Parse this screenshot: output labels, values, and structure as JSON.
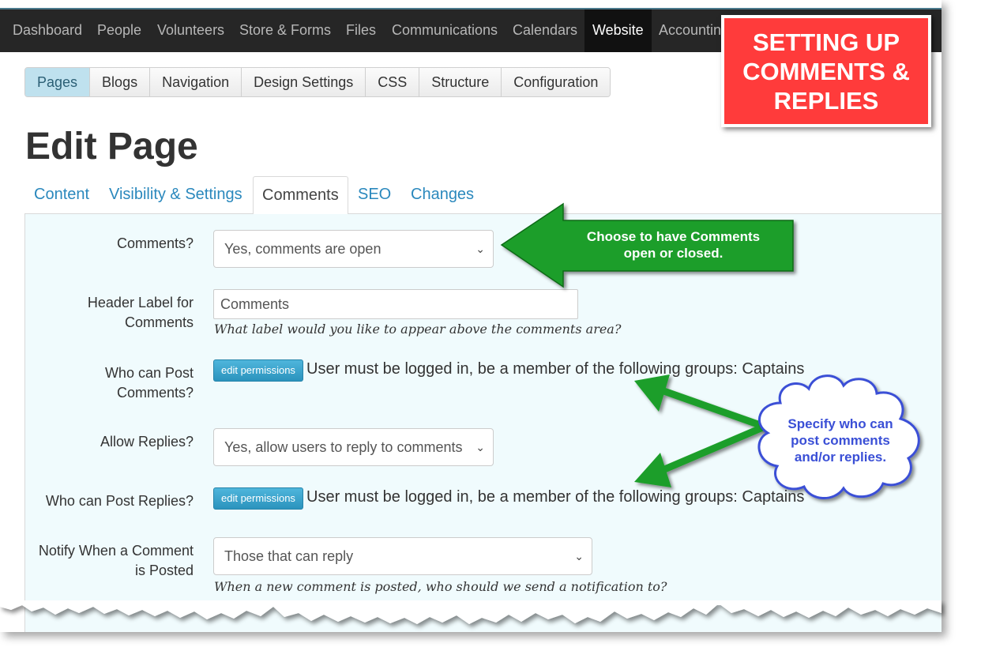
{
  "topnav": {
    "items": [
      "Dashboard",
      "People",
      "Volunteers",
      "Store & Forms",
      "Files",
      "Communications",
      "Calendars",
      "Website",
      "Accounting"
    ],
    "active": "Website"
  },
  "subtabs": {
    "items": [
      "Pages",
      "Blogs",
      "Navigation",
      "Design Settings",
      "CSS",
      "Structure",
      "Configuration"
    ],
    "active": "Pages"
  },
  "page": {
    "title": "Edit Page"
  },
  "tabs": {
    "items": [
      "Content",
      "Visibility & Settings",
      "Comments",
      "SEO",
      "Changes"
    ],
    "active": "Comments"
  },
  "form": {
    "comments": {
      "label": "Comments?",
      "value": "Yes, comments are open"
    },
    "header_label": {
      "label_line1": "Header Label for",
      "label_line2": "Comments",
      "value": "Comments",
      "help": "What label would you like to appear above the comments area?"
    },
    "who_post_comments": {
      "label_line1": "Who can Post",
      "label_line2": "Comments?",
      "button": "edit permissions",
      "text": "User must be logged in, be a member of the following groups: Captains"
    },
    "allow_replies": {
      "label": "Allow Replies?",
      "value": "Yes, allow users to reply to comments"
    },
    "who_post_replies": {
      "label": "Who can Post Replies?",
      "button": "edit permissions",
      "text": "User must be logged in, be a member of the following groups: Captains"
    },
    "notify": {
      "label_line1": "Notify When a Comment",
      "label_line2": "is Posted",
      "value": "Those that can reply",
      "help": "When a new comment is posted, who should we send a notification to?"
    }
  },
  "annotations": {
    "title_lines": [
      "SETTING UP",
      "COMMENTS &",
      "REPLIES"
    ],
    "arrow_lines": [
      "Choose to have Comments",
      "open or closed."
    ],
    "cloud_lines": [
      "Specify who can",
      "post comments",
      "and/or replies."
    ]
  },
  "colors": {
    "topnav_bg": "#262626",
    "link": "#2a88bd",
    "panel_bg": "#f0fbfd",
    "callout_red": "#ff3b3b",
    "arrow_green": "#1e9e2a",
    "cloud_text": "#3a4fd6"
  }
}
